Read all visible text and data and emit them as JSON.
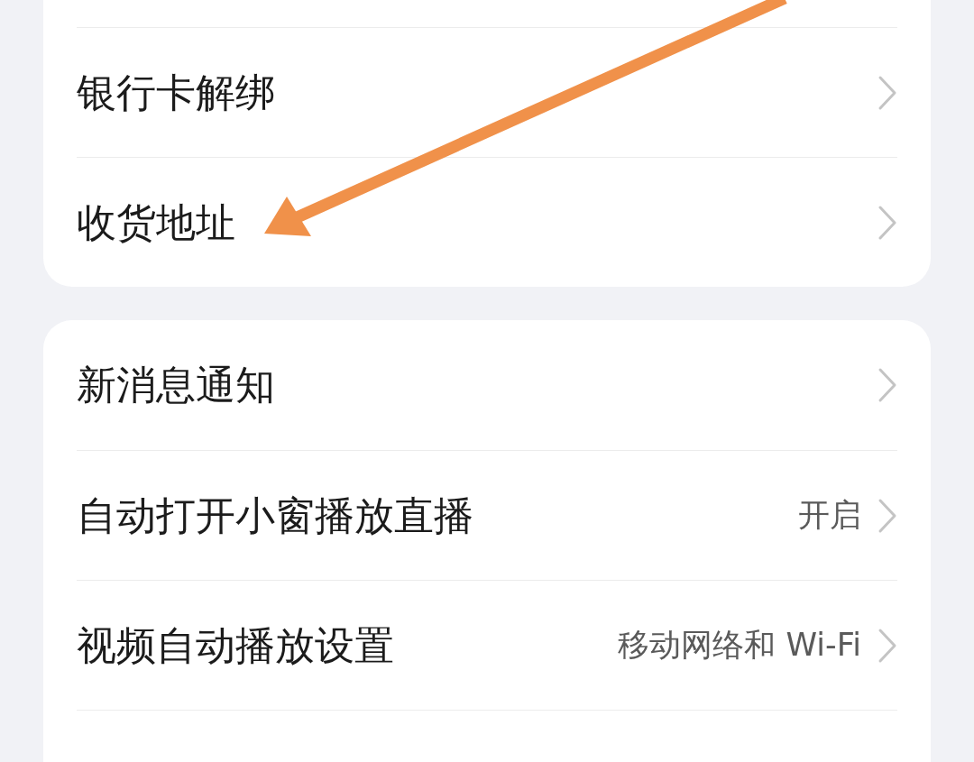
{
  "cards": [
    {
      "rows": [
        {
          "label": "银行卡解绑"
        },
        {
          "label": "收货地址"
        }
      ]
    },
    {
      "rows": [
        {
          "label": "新消息通知"
        },
        {
          "label": "自动打开小窗播放直播",
          "value": "开启"
        },
        {
          "label": "视频自动播放设置",
          "value": "移动网络和 Wi-Fi"
        }
      ]
    }
  ]
}
